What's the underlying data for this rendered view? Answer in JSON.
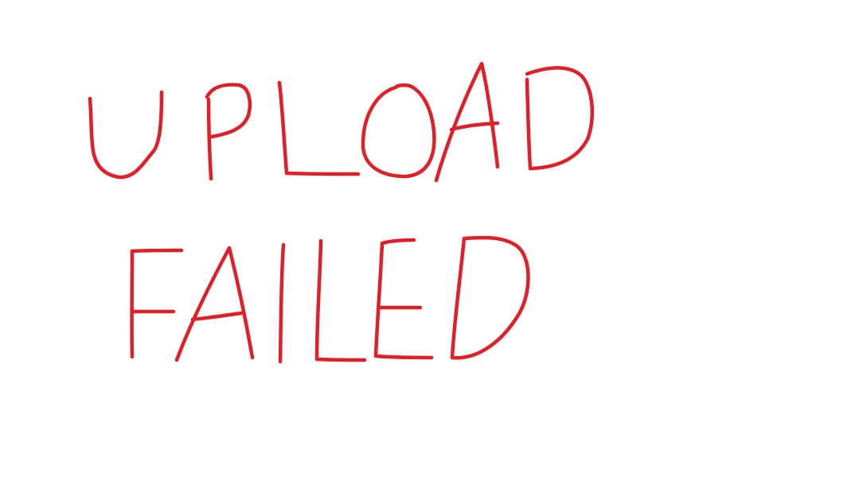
{
  "message": {
    "line1": "UPLOAD",
    "line2": "FAILED"
  },
  "colors": {
    "ink": "#e02028",
    "background": "#ffffff"
  }
}
